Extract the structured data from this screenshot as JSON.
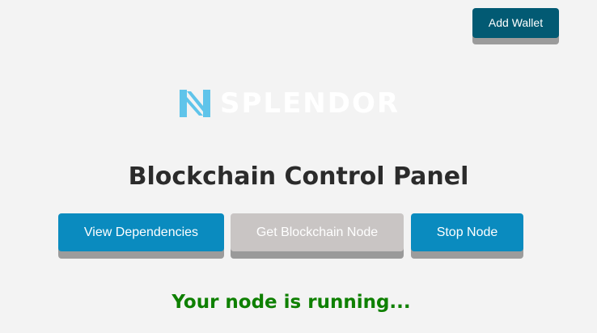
{
  "header": {
    "add_wallet_label": "Add Wallet"
  },
  "logo": {
    "brand_text": "SPLENDOR",
    "icon": "splendor-logo-mark"
  },
  "main": {
    "title": "Blockchain Control Panel",
    "buttons": {
      "view_dependencies": "View Dependencies",
      "get_blockchain_node": "Get Blockchain Node",
      "stop_node": "Stop Node"
    },
    "status_text": "Your node is running..."
  },
  "colors": {
    "background": "#f3f3f3",
    "add_wallet_bg": "#025a73",
    "primary_button": "#0a8bbf",
    "disabled_button": "#c9c5c4",
    "status_green": "#0e8000",
    "logo_blue": "#5fc4ea"
  }
}
